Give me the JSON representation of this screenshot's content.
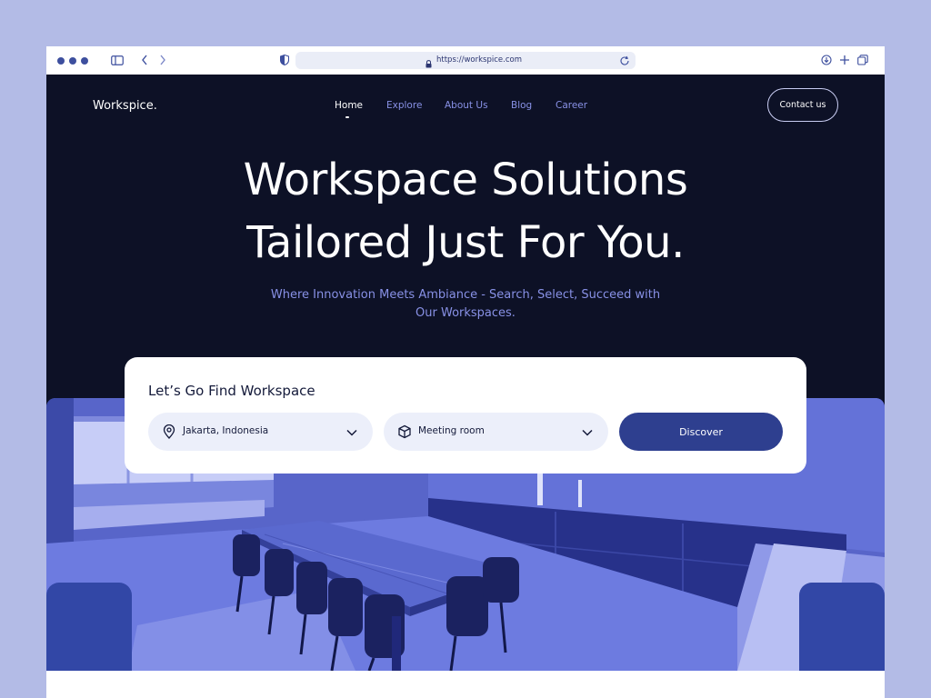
{
  "browser": {
    "url": "https://workspice.com",
    "icons": [
      "sidebar-icon",
      "back-icon",
      "forward-icon",
      "shield-icon",
      "lock-icon",
      "reload-icon",
      "download-icon",
      "new-tab-icon",
      "tabs-icon"
    ]
  },
  "header": {
    "logo": "Workspice.",
    "nav": [
      "Home",
      "Explore",
      "About Us",
      "Blog",
      "Career"
    ],
    "active_nav": "Home",
    "contact_label": "Contact us"
  },
  "hero": {
    "title_line1": "Workspace Solutions",
    "title_line2": "Tailored Just For You.",
    "subtitle_line1": "Where Innovation Meets Ambiance - Search, Select, Succeed with",
    "subtitle_line2": "Our Workspaces."
  },
  "search": {
    "title": "Let’s Go Find Workspace",
    "location_value": "Jakarta, Indonesia",
    "type_value": "Meeting room",
    "discover_label": "Discover"
  },
  "colors": {
    "page_bg": "#b3bbe6",
    "hero_bg": "#0d1126",
    "accent": "#2e3f8f",
    "nav_link": "#8891e6"
  }
}
